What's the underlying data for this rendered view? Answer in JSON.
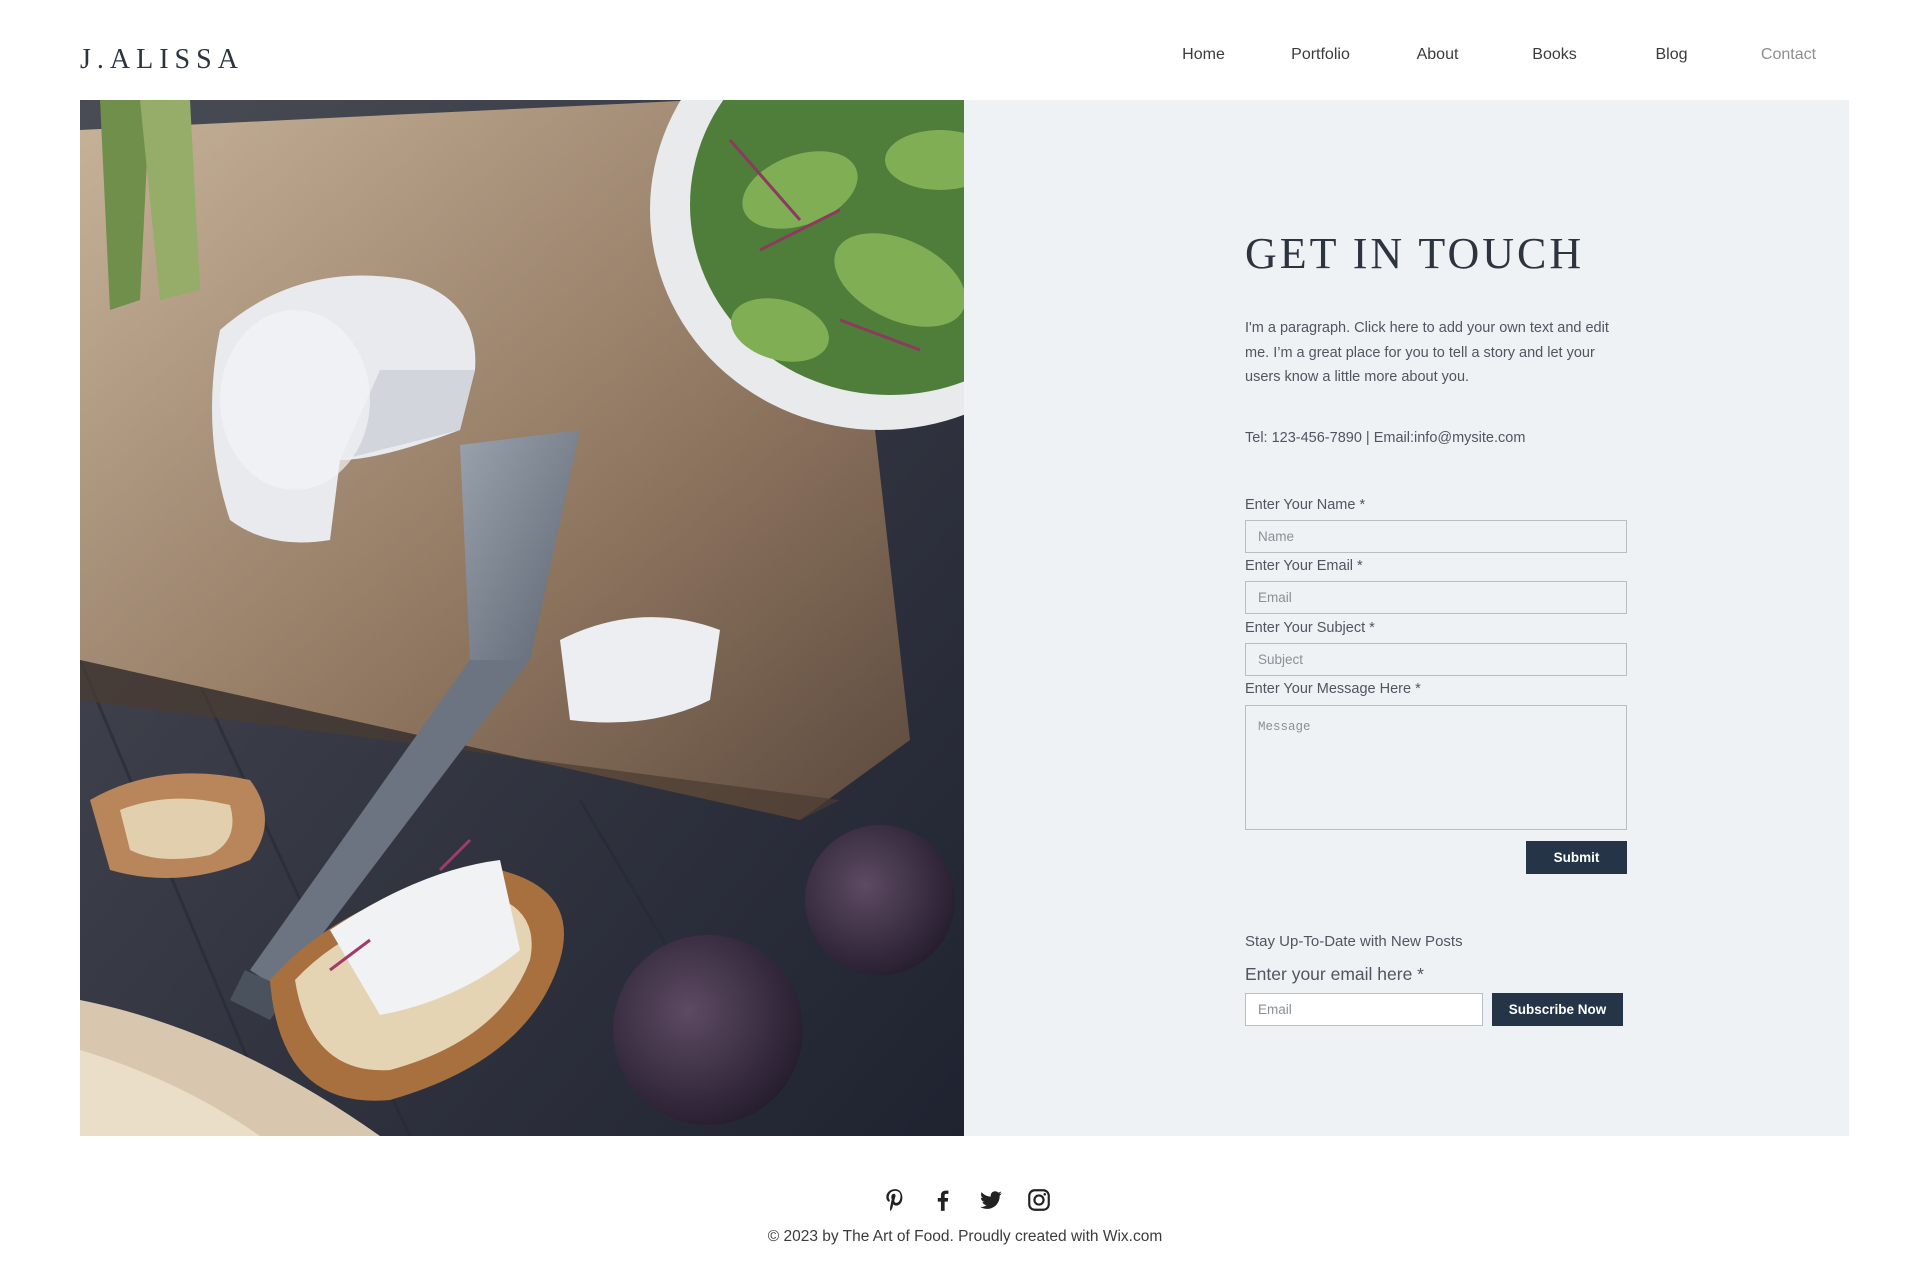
{
  "header": {
    "logo": "J.ALISSA",
    "nav": [
      {
        "label": "Home"
      },
      {
        "label": "Portfolio"
      },
      {
        "label": "About"
      },
      {
        "label": "Books"
      },
      {
        "label": "Blog"
      },
      {
        "label": "Contact",
        "active": true
      }
    ]
  },
  "hero": {
    "icon": "food-photo-cheese-figs-salad"
  },
  "contact": {
    "title": "GET IN TOUCH",
    "paragraph": "I'm a paragraph. Click here to add your own text and edit me. I’m a great place for you to tell a story and let your users know a little more about you.",
    "contact_line": "Tel: 123-456-7890 | Email:info@mysite.com",
    "form": {
      "name_label": "Enter Your Name *",
      "name_placeholder": "Name",
      "email_label": "Enter Your Email *",
      "email_placeholder": "Email",
      "subject_label": "Enter Your Subject *",
      "subject_placeholder": "Subject",
      "message_label": "Enter Your Message Here *",
      "message_placeholder": "Message",
      "submit_label": "Submit"
    },
    "newsletter": {
      "title": "Stay Up-To-Date with New Posts",
      "email_label": "Enter your email here *",
      "email_placeholder": "Email",
      "button_label": "Subscribe Now"
    }
  },
  "footer": {
    "social": [
      {
        "name": "pinterest-icon"
      },
      {
        "name": "facebook-icon"
      },
      {
        "name": "twitter-icon"
      },
      {
        "name": "instagram-icon"
      }
    ],
    "copyright": "© 2023 by The Art of Food. Proudly created with Wix.com"
  },
  "colors": {
    "accent": "#253447",
    "panel_bg": "#eff2f5",
    "text": "#505560"
  }
}
